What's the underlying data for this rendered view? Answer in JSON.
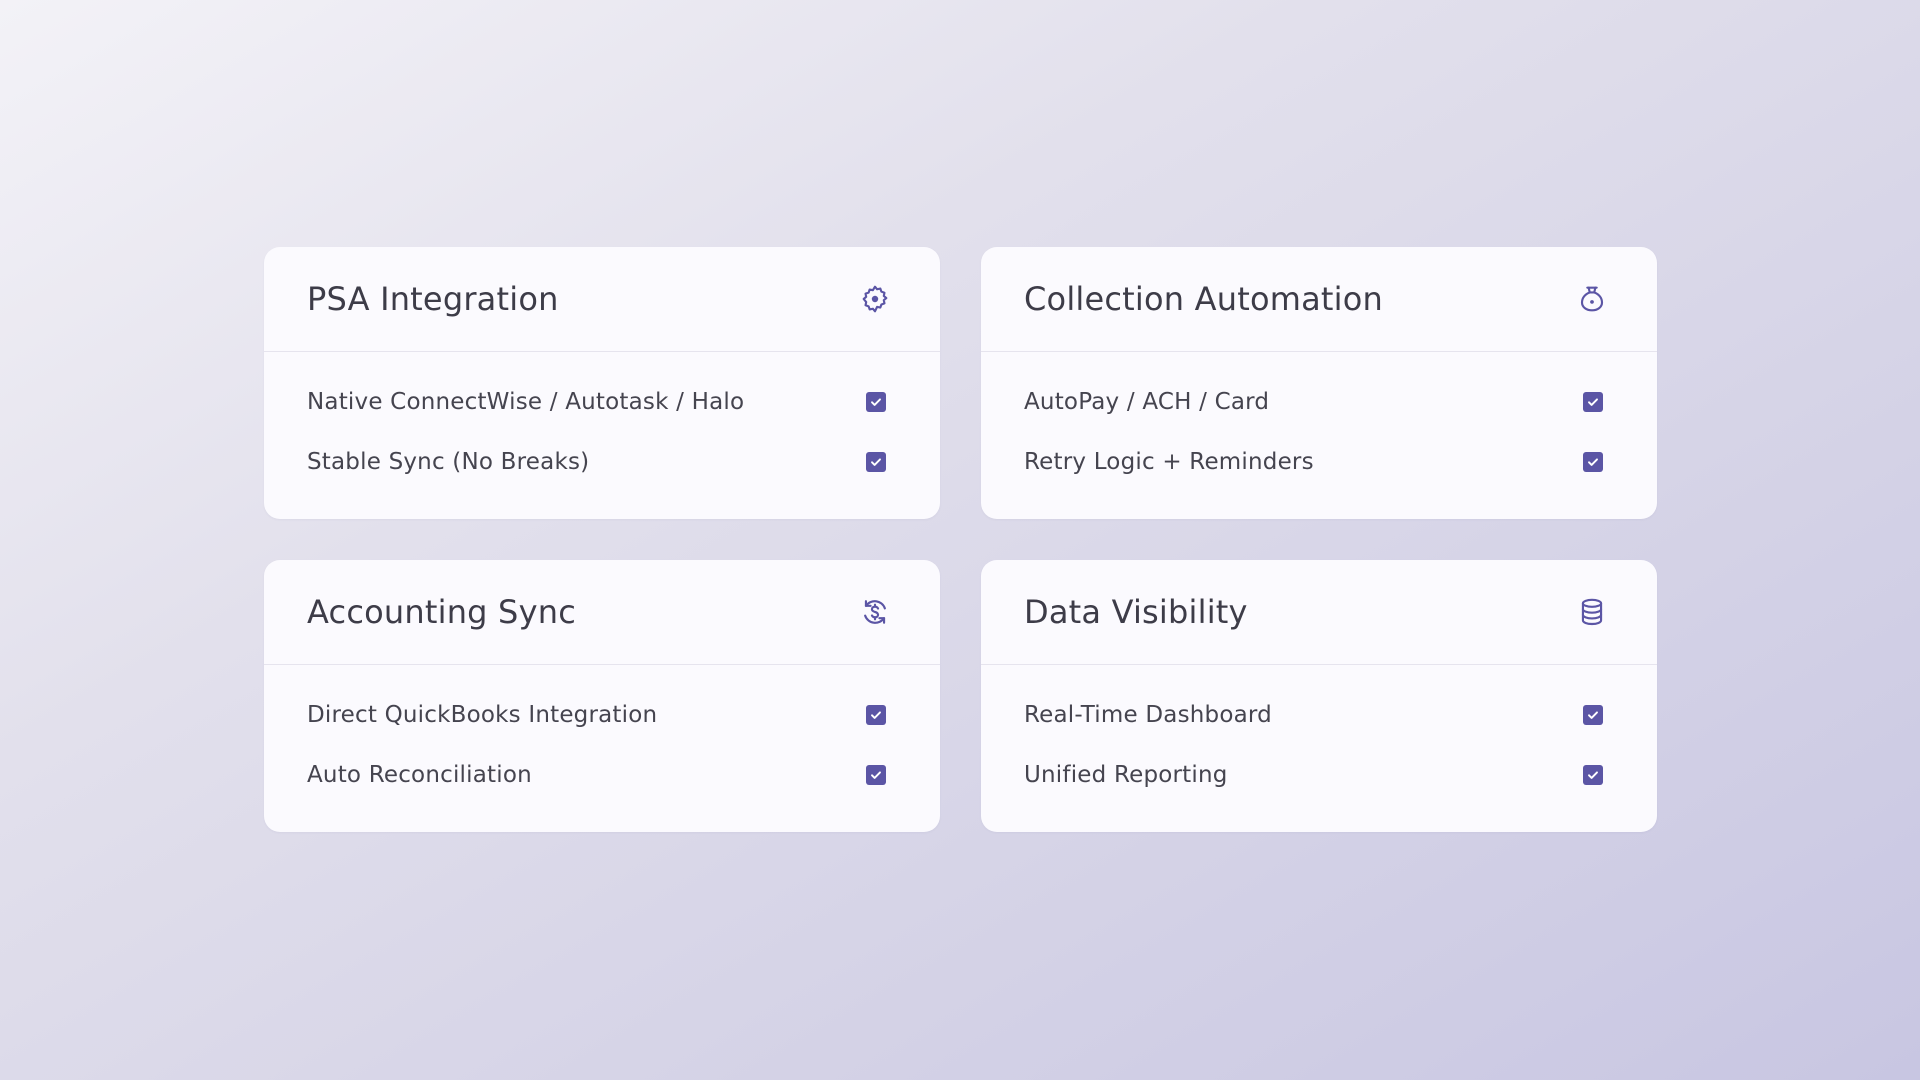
{
  "accent_color": "#5b55a5",
  "cards": [
    {
      "title": "PSA Integration",
      "icon": "gear-icon",
      "items": [
        {
          "label": "Native ConnectWise / Autotask / Halo",
          "checked": true
        },
        {
          "label": "Stable Sync (No Breaks)",
          "checked": true
        }
      ]
    },
    {
      "title": "Collection Automation",
      "icon": "money-bag-icon",
      "items": [
        {
          "label": "AutoPay / ACH / Card",
          "checked": true
        },
        {
          "label": "Retry Logic + Reminders",
          "checked": true
        }
      ]
    },
    {
      "title": "Accounting Sync",
      "icon": "dollar-sync-icon",
      "items": [
        {
          "label": "Direct QuickBooks Integration",
          "checked": true
        },
        {
          "label": "Auto Reconciliation",
          "checked": true
        }
      ]
    },
    {
      "title": "Data Visibility",
      "icon": "database-icon",
      "items": [
        {
          "label": "Real-Time Dashboard",
          "checked": true
        },
        {
          "label": "Unified Reporting",
          "checked": true
        }
      ]
    }
  ]
}
